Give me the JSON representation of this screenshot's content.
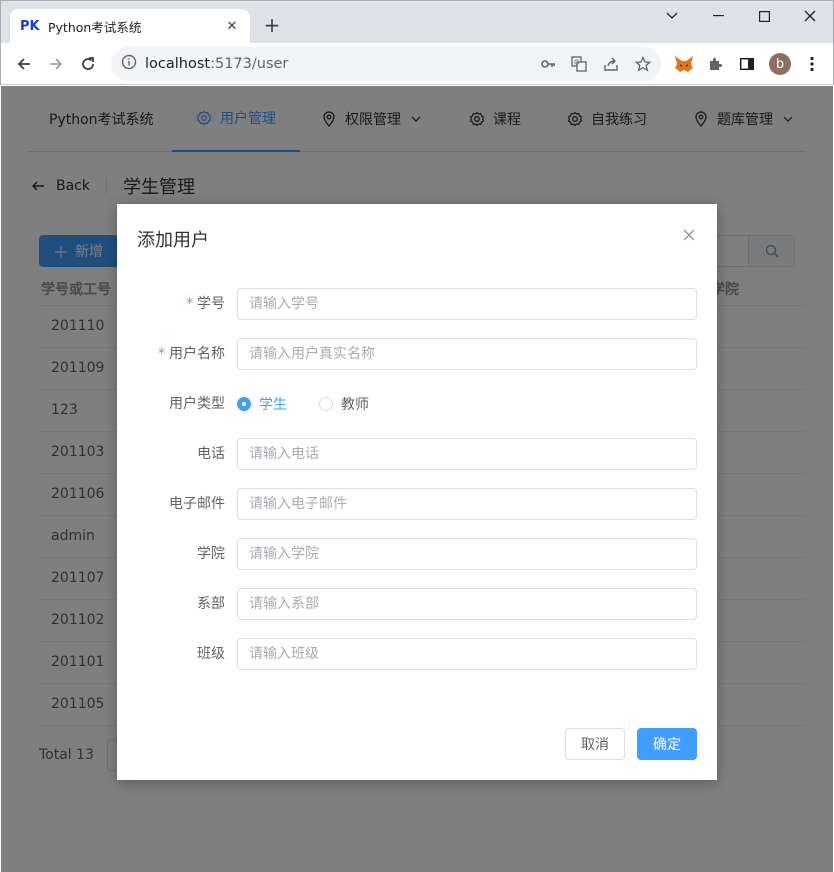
{
  "browser": {
    "favicon_text": "PK",
    "tab_title": "Python考试系统",
    "url_host": "localhost",
    "url_rest": ":5173/user",
    "profile_initial": "b"
  },
  "nav": {
    "brand": "Python考试系统",
    "items": [
      {
        "label": "用户管理",
        "icon": "gear-icon",
        "active": true
      },
      {
        "label": "权限管理",
        "icon": "location-icon",
        "dropdown": true
      },
      {
        "label": "课程",
        "icon": "gear-icon"
      },
      {
        "label": "自我练习",
        "icon": "gear-icon"
      },
      {
        "label": "题库管理",
        "icon": "location-icon",
        "dropdown": true
      }
    ]
  },
  "page_header": {
    "back_label": "Back",
    "title": "学生管理"
  },
  "toolbar": {
    "add_label": "新增"
  },
  "table": {
    "headers": [
      "学号或工号",
      "学院"
    ],
    "rows": [
      "201110",
      "201109",
      "123",
      "201103",
      "201106",
      "admin",
      "201107",
      "201102",
      "201101",
      "201105"
    ]
  },
  "pagination": {
    "total_label": "Total 13"
  },
  "dialog": {
    "title": "添加用户",
    "fields": [
      {
        "label": "学号",
        "required": true,
        "placeholder": "请输入学号"
      },
      {
        "label": "用户名称",
        "required": true,
        "placeholder": "请输入用户真实名称"
      },
      {
        "label": "用户类型",
        "type": "radio",
        "options": [
          "学生",
          "教师"
        ],
        "selected": "学生"
      },
      {
        "label": "电话",
        "placeholder": "请输入电话"
      },
      {
        "label": "电子邮件",
        "placeholder": "请输入电子邮件"
      },
      {
        "label": "学院",
        "placeholder": "请输入学院"
      },
      {
        "label": "系部",
        "placeholder": "请输入系部"
      },
      {
        "label": "班级",
        "placeholder": "请输入班级"
      }
    ],
    "cancel_label": "取消",
    "confirm_label": "确定"
  },
  "colors": {
    "primary": "#409eff",
    "required": "#f56c6c",
    "overlay": "rgba(0,0,0,0.5)"
  }
}
